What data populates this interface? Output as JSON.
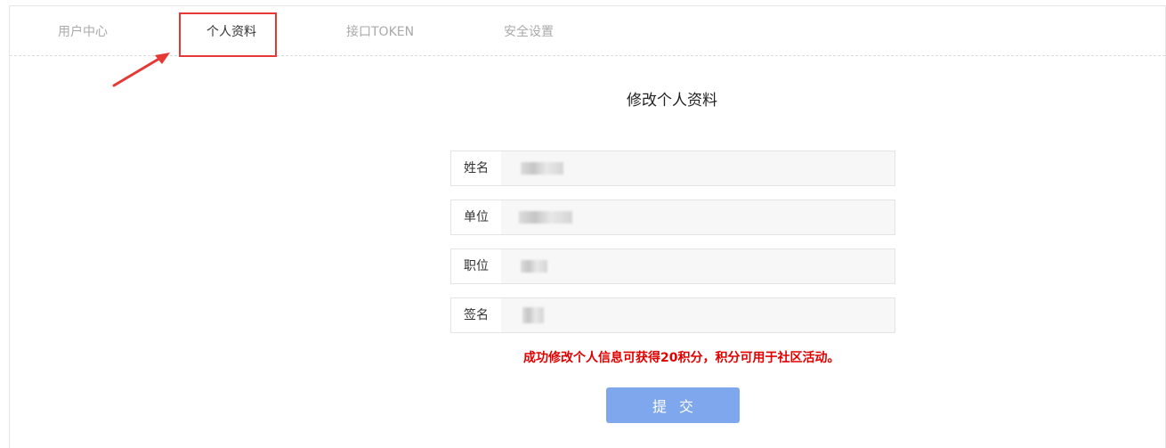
{
  "tabs": [
    {
      "label": "用户中心",
      "active": false
    },
    {
      "label": "个人资料",
      "active": true
    },
    {
      "label": "接口TOKEN",
      "active": false
    },
    {
      "label": "安全设置",
      "active": false
    }
  ],
  "form": {
    "title": "修改个人资料",
    "fields": [
      {
        "label": "姓名",
        "value": ""
      },
      {
        "label": "单位",
        "value": ""
      },
      {
        "label": "职位",
        "value": ""
      },
      {
        "label": "签名",
        "value": ""
      }
    ],
    "notice": "成功修改个人信息可获得20积分，积分可用于社区活动。",
    "submit_label": "提交"
  },
  "colors": {
    "highlight": "#e53935",
    "notice": "#e00000",
    "submit_bg": "#7ea7ee"
  }
}
